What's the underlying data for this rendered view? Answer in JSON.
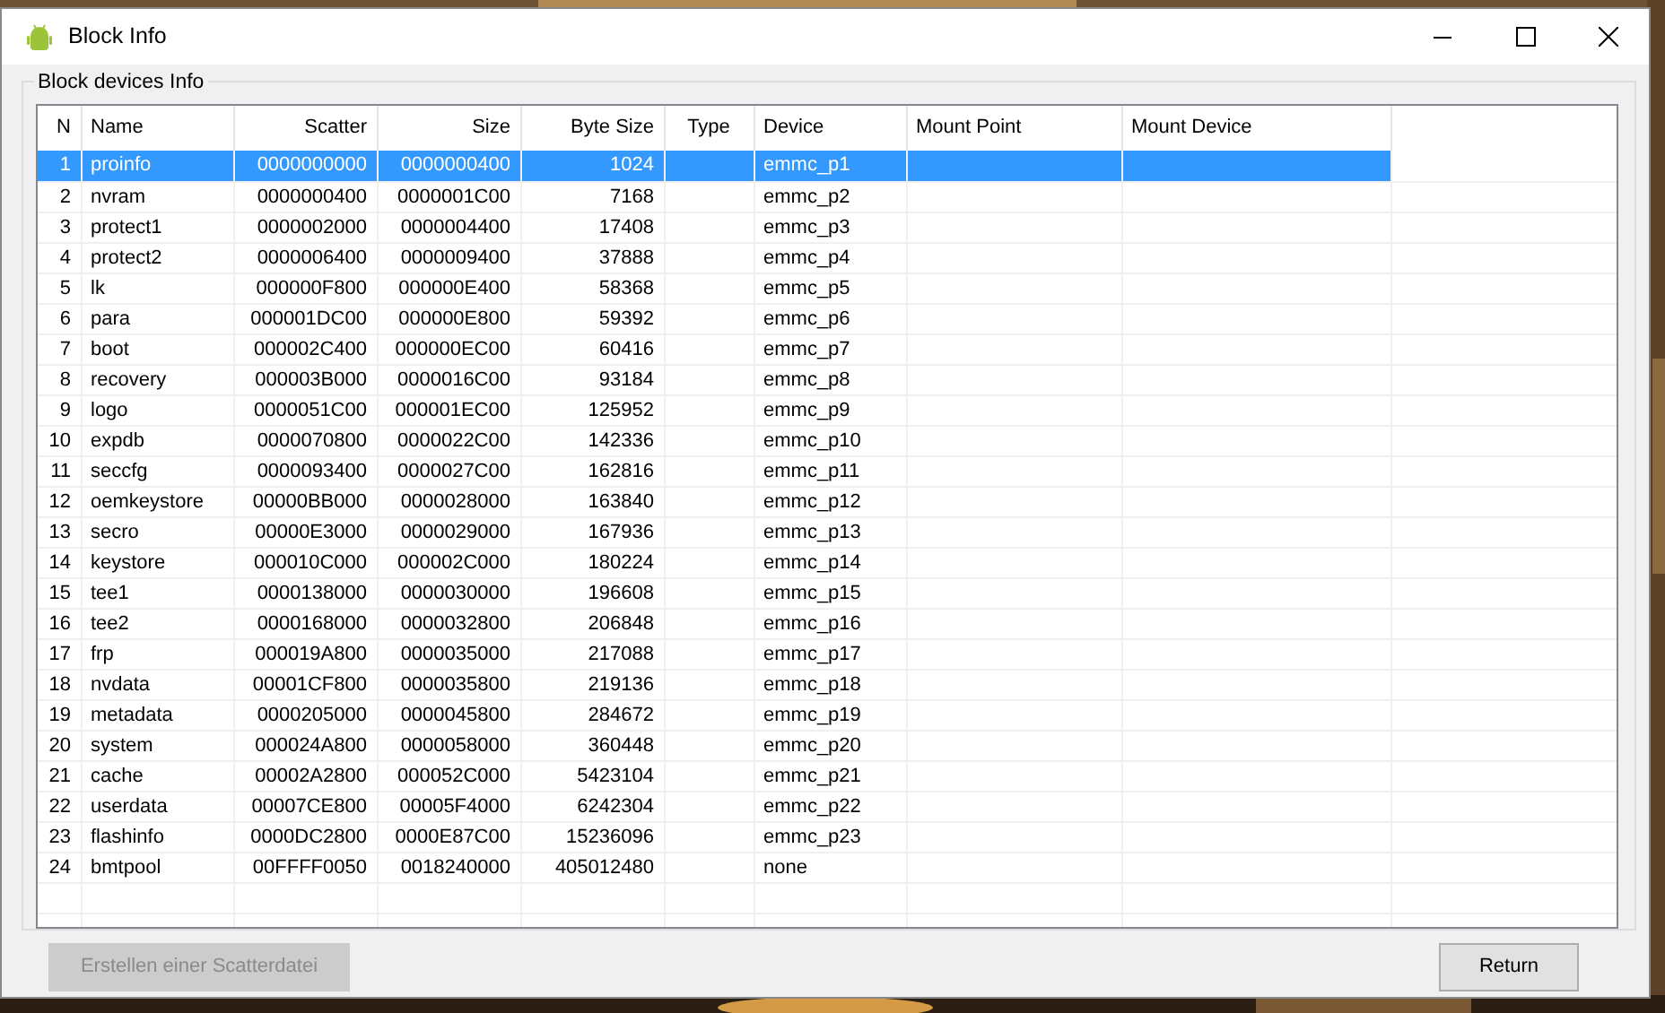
{
  "window": {
    "title": "Block Info"
  },
  "group": {
    "title": "Block devices Info"
  },
  "table": {
    "columns": [
      "N",
      "Name",
      "Scatter",
      "Size",
      "Byte Size",
      "Type",
      "Device",
      "Mount Point",
      "Mount Device"
    ],
    "rows": [
      {
        "n": "1",
        "name": "proinfo",
        "scatter": "0000000000",
        "size": "0000000400",
        "byte_size": "1024",
        "device": "emmc_p1",
        "selected": true
      },
      {
        "n": "2",
        "name": "nvram",
        "scatter": "0000000400",
        "size": "0000001C00",
        "byte_size": "7168",
        "device": "emmc_p2",
        "selected": false
      },
      {
        "n": "3",
        "name": "protect1",
        "scatter": "0000002000",
        "size": "0000004400",
        "byte_size": "17408",
        "device": "emmc_p3",
        "selected": false
      },
      {
        "n": "4",
        "name": "protect2",
        "scatter": "0000006400",
        "size": "0000009400",
        "byte_size": "37888",
        "device": "emmc_p4",
        "selected": false
      },
      {
        "n": "5",
        "name": "lk",
        "scatter": "000000F800",
        "size": "000000E400",
        "byte_size": "58368",
        "device": "emmc_p5",
        "selected": false
      },
      {
        "n": "6",
        "name": "para",
        "scatter": "000001DC00",
        "size": "000000E800",
        "byte_size": "59392",
        "device": "emmc_p6",
        "selected": false
      },
      {
        "n": "7",
        "name": "boot",
        "scatter": "000002C400",
        "size": "000000EC00",
        "byte_size": "60416",
        "device": "emmc_p7",
        "selected": false
      },
      {
        "n": "8",
        "name": "recovery",
        "scatter": "000003B000",
        "size": "0000016C00",
        "byte_size": "93184",
        "device": "emmc_p8",
        "selected": false
      },
      {
        "n": "9",
        "name": "logo",
        "scatter": "0000051C00",
        "size": "000001EC00",
        "byte_size": "125952",
        "device": "emmc_p9",
        "selected": false
      },
      {
        "n": "10",
        "name": "expdb",
        "scatter": "0000070800",
        "size": "0000022C00",
        "byte_size": "142336",
        "device": "emmc_p10",
        "selected": false
      },
      {
        "n": "11",
        "name": "seccfg",
        "scatter": "0000093400",
        "size": "0000027C00",
        "byte_size": "162816",
        "device": "emmc_p11",
        "selected": false
      },
      {
        "n": "12",
        "name": "oemkeystore",
        "scatter": "00000BB000",
        "size": "0000028000",
        "byte_size": "163840",
        "device": "emmc_p12",
        "selected": false
      },
      {
        "n": "13",
        "name": "secro",
        "scatter": "00000E3000",
        "size": "0000029000",
        "byte_size": "167936",
        "device": "emmc_p13",
        "selected": false
      },
      {
        "n": "14",
        "name": "keystore",
        "scatter": "000010C000",
        "size": "000002C000",
        "byte_size": "180224",
        "device": "emmc_p14",
        "selected": false
      },
      {
        "n": "15",
        "name": "tee1",
        "scatter": "0000138000",
        "size": "0000030000",
        "byte_size": "196608",
        "device": "emmc_p15",
        "selected": false
      },
      {
        "n": "16",
        "name": "tee2",
        "scatter": "0000168000",
        "size": "0000032800",
        "byte_size": "206848",
        "device": "emmc_p16",
        "selected": false
      },
      {
        "n": "17",
        "name": "frp",
        "scatter": "000019A800",
        "size": "0000035000",
        "byte_size": "217088",
        "device": "emmc_p17",
        "selected": false
      },
      {
        "n": "18",
        "name": "nvdata",
        "scatter": "00001CF800",
        "size": "0000035800",
        "byte_size": "219136",
        "device": "emmc_p18",
        "selected": false
      },
      {
        "n": "19",
        "name": "metadata",
        "scatter": "0000205000",
        "size": "0000045800",
        "byte_size": "284672",
        "device": "emmc_p19",
        "selected": false
      },
      {
        "n": "20",
        "name": "system",
        "scatter": "000024A800",
        "size": "0000058000",
        "byte_size": "360448",
        "device": "emmc_p20",
        "selected": false
      },
      {
        "n": "21",
        "name": "cache",
        "scatter": "00002A2800",
        "size": "000052C000",
        "byte_size": "5423104",
        "device": "emmc_p21",
        "selected": false
      },
      {
        "n": "22",
        "name": "userdata",
        "scatter": "00007CE800",
        "size": "00005F4000",
        "byte_size": "6242304",
        "device": "emmc_p22",
        "selected": false
      },
      {
        "n": "23",
        "name": "flashinfo",
        "scatter": "0000DC2800",
        "size": "0000E87C00",
        "byte_size": "15236096",
        "device": "emmc_p23",
        "selected": false
      },
      {
        "n": "24",
        "name": "bmtpool",
        "scatter": "00FFFF0050",
        "size": "0018240000",
        "byte_size": "405012480",
        "device": "none",
        "selected": false
      }
    ]
  },
  "buttons": [
    {
      "label": "Erstellen einer Scatterdatei",
      "disabled": true
    },
    {
      "label": "Return",
      "disabled": false
    }
  ]
}
